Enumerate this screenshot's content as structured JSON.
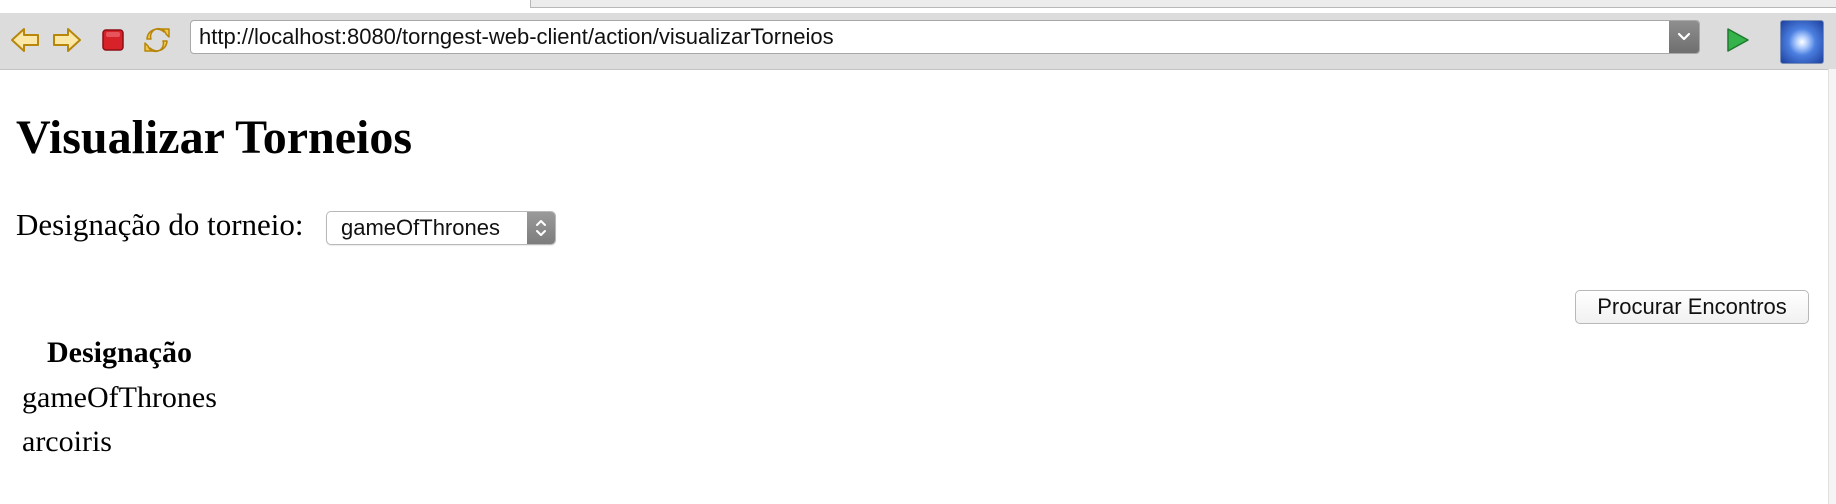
{
  "browser": {
    "url": "http://localhost:8080/torngest-web-client/action/visualizarTorneios",
    "icons": {
      "back": "back-arrow-icon",
      "forward": "forward-arrow-icon",
      "stop": "stop-icon",
      "refresh": "refresh-icon",
      "url_dropdown": "chevron-down-icon",
      "go": "play-icon",
      "extension": "extension-icon"
    }
  },
  "page": {
    "title": "Visualizar Torneios",
    "field_label": "Designação do torneio:",
    "selected_tournament": "gameOfThrones",
    "search_button": "Procurar Encontros"
  },
  "table": {
    "header": "Designação",
    "rows": [
      "gameOfThrones",
      "arcoiris"
    ]
  }
}
